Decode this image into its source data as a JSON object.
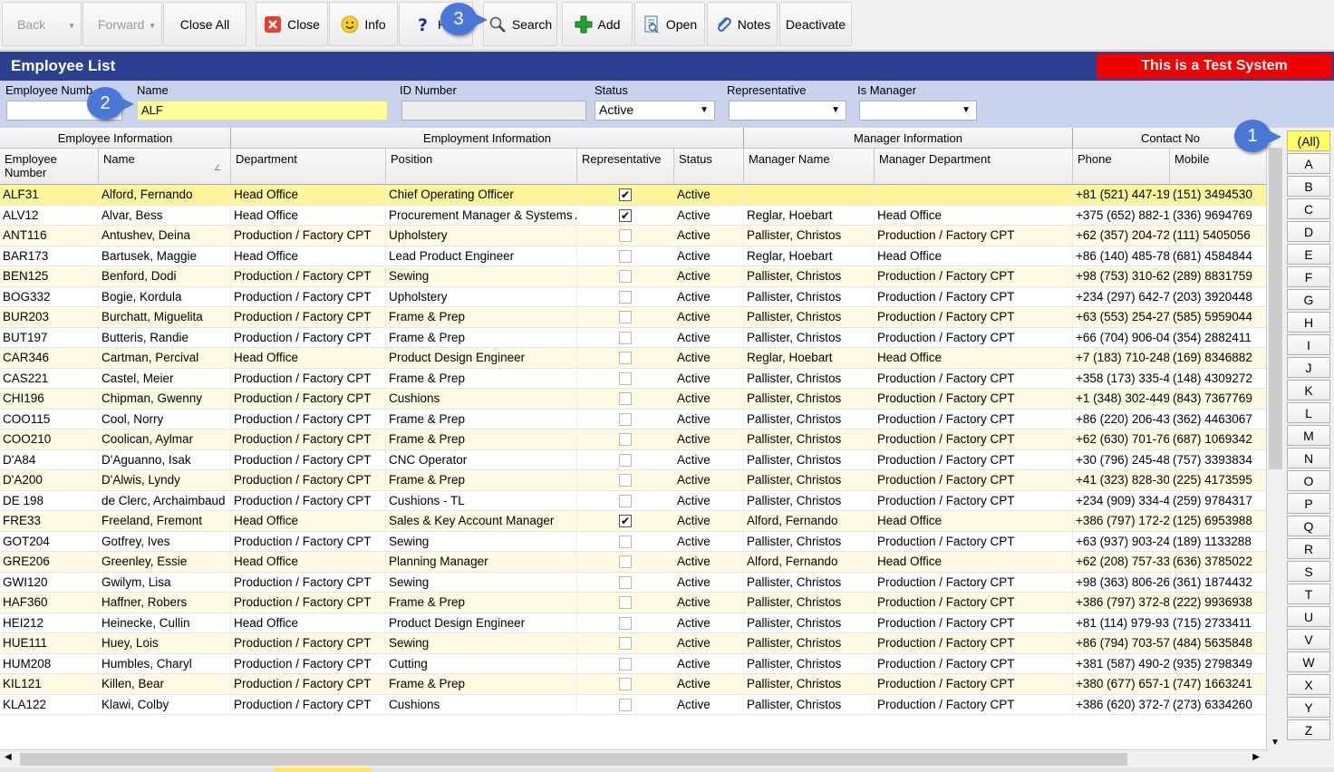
{
  "toolbar": {
    "back": "Back",
    "forward": "Forward",
    "close_all": "Close All",
    "close": "Close",
    "info": "Info",
    "help": "H",
    "search": "Search",
    "add": "Add",
    "open": "Open",
    "notes": "Notes",
    "deactivate": "Deactivate"
  },
  "title": "Employee List",
  "test_banner": "This is a Test System",
  "filters": {
    "employee_number_label": "Employee Numb",
    "employee_number_value": "",
    "name_label": "Name",
    "name_value": "ALF",
    "id_number_label": "ID Number",
    "id_number_value": "",
    "status_label": "Status",
    "status_value": "Active",
    "representative_label": "Representative",
    "representative_value": "",
    "is_manager_label": "Is Manager",
    "is_manager_value": ""
  },
  "groups": {
    "employee_info": "Employee Information",
    "employment_info": "Employment Information",
    "manager_info": "Manager Information",
    "contact": "Contact No"
  },
  "columns": {
    "emp_no": "Employee Number",
    "name": "Name",
    "department": "Department",
    "position": "Position",
    "representative": "Representative",
    "status": "Status",
    "manager_name": "Manager Name",
    "manager_dept": "Manager Department",
    "phone": "Phone",
    "mobile": "Mobile"
  },
  "rows": [
    {
      "emp": "ALF31",
      "name": "Alford, Fernando",
      "dept": "Head Office",
      "pos": "Chief Operating Officer",
      "rep": true,
      "status": "Active",
      "mgr": "",
      "mgrdept": "",
      "phone": "+81 (521) 447-19",
      "mobile": "(151) 3494530"
    },
    {
      "emp": "ALV12",
      "name": "Alvar, Bess",
      "dept": "Head Office",
      "pos": "Procurement Manager & Systems A",
      "rep": true,
      "status": "Active",
      "mgr": "Reglar, Hoebart",
      "mgrdept": "Head Office",
      "phone": "+375 (652) 882-1",
      "mobile": "(336) 9694769"
    },
    {
      "emp": "ANT116",
      "name": "Antushev, Deina",
      "dept": "Production / Factory CPT",
      "pos": "Upholstery",
      "rep": false,
      "status": "Active",
      "mgr": "Pallister, Christos",
      "mgrdept": "Production / Factory CPT",
      "phone": "+62 (357) 204-72",
      "mobile": "(111) 5405056"
    },
    {
      "emp": "BAR173",
      "name": "Bartusek, Maggie",
      "dept": "Head Office",
      "pos": "Lead Product Engineer",
      "rep": false,
      "status": "Active",
      "mgr": "Reglar, Hoebart",
      "mgrdept": "Head Office",
      "phone": "+86 (140) 485-78",
      "mobile": "(681) 4584844"
    },
    {
      "emp": "BEN125",
      "name": "Benford, Dodi",
      "dept": "Production / Factory CPT",
      "pos": "Sewing",
      "rep": false,
      "status": "Active",
      "mgr": "Pallister, Christos",
      "mgrdept": "Production / Factory CPT",
      "phone": "+98 (753) 310-62",
      "mobile": "(289) 8831759"
    },
    {
      "emp": "BOG332",
      "name": "Bogie, Kordula",
      "dept": "Production / Factory CPT",
      "pos": "Upholstery",
      "rep": false,
      "status": "Active",
      "mgr": "Pallister, Christos",
      "mgrdept": "Production / Factory CPT",
      "phone": "+234 (297) 642-7",
      "mobile": "(203) 3920448"
    },
    {
      "emp": "BUR203",
      "name": "Burchatt, Miguelita",
      "dept": "Production / Factory CPT",
      "pos": "Frame & Prep",
      "rep": false,
      "status": "Active",
      "mgr": "Pallister, Christos",
      "mgrdept": "Production / Factory CPT",
      "phone": "+63 (553) 254-27",
      "mobile": "(585) 5959044"
    },
    {
      "emp": "BUT197",
      "name": "Butteris, Randie",
      "dept": "Production / Factory CPT",
      "pos": "Frame & Prep",
      "rep": false,
      "status": "Active",
      "mgr": "Pallister, Christos",
      "mgrdept": "Production / Factory CPT",
      "phone": "+66 (704) 906-04",
      "mobile": "(354) 2882411"
    },
    {
      "emp": "CAR346",
      "name": "Cartman, Percival",
      "dept": "Head Office",
      "pos": "Product Design Engineer",
      "rep": false,
      "status": "Active",
      "mgr": "Reglar, Hoebart",
      "mgrdept": "Head Office",
      "phone": "+7 (183) 710-248",
      "mobile": "(169) 8346882"
    },
    {
      "emp": "CAS221",
      "name": "Castel, Meier",
      "dept": "Production / Factory CPT",
      "pos": "Frame & Prep",
      "rep": false,
      "status": "Active",
      "mgr": "Pallister, Christos",
      "mgrdept": "Production / Factory CPT",
      "phone": "+358 (173) 335-4",
      "mobile": "(148) 4309272"
    },
    {
      "emp": "CHI196",
      "name": "Chipman, Gwenny",
      "dept": "Production / Factory CPT",
      "pos": "Cushions",
      "rep": false,
      "status": "Active",
      "mgr": "Pallister, Christos",
      "mgrdept": "Production / Factory CPT",
      "phone": "+1 (348) 302-449",
      "mobile": "(843) 7367769"
    },
    {
      "emp": "COO115",
      "name": "Cool, Norry",
      "dept": "Production / Factory CPT",
      "pos": "Frame & Prep",
      "rep": false,
      "status": "Active",
      "mgr": "Pallister, Christos",
      "mgrdept": "Production / Factory CPT",
      "phone": "+86 (220) 206-43",
      "mobile": "(362) 4463067"
    },
    {
      "emp": "COO210",
      "name": "Coolican, Aylmar",
      "dept": "Production / Factory CPT",
      "pos": "Frame & Prep",
      "rep": false,
      "status": "Active",
      "mgr": "Pallister, Christos",
      "mgrdept": "Production / Factory CPT",
      "phone": "+62 (630) 701-76",
      "mobile": "(687) 1069342"
    },
    {
      "emp": "D'A84",
      "name": "D'Aguanno, Isak",
      "dept": "Production / Factory CPT",
      "pos": "CNC Operator",
      "rep": false,
      "status": "Active",
      "mgr": "Pallister, Christos",
      "mgrdept": "Production / Factory CPT",
      "phone": "+30 (796) 245-48",
      "mobile": "(757) 3393834"
    },
    {
      "emp": "D'A200",
      "name": "D'Alwis, Lyndy",
      "dept": "Production / Factory CPT",
      "pos": "Frame & Prep",
      "rep": false,
      "status": "Active",
      "mgr": "Pallister, Christos",
      "mgrdept": "Production / Factory CPT",
      "phone": "+41 (323) 828-30",
      "mobile": "(225) 4173595"
    },
    {
      "emp": "DE 198",
      "name": "de Clerc, Archaimbaud",
      "dept": "Production / Factory CPT",
      "pos": "Cushions - TL",
      "rep": false,
      "status": "Active",
      "mgr": "Pallister, Christos",
      "mgrdept": "Production / Factory CPT",
      "phone": "+234 (909) 334-4",
      "mobile": "(259) 9784317"
    },
    {
      "emp": "FRE33",
      "name": "Freeland, Fremont",
      "dept": "Head Office",
      "pos": "Sales & Key Account Manager",
      "rep": true,
      "status": "Active",
      "mgr": "Alford, Fernando",
      "mgrdept": "Head Office",
      "phone": "+386 (797) 172-2",
      "mobile": "(125) 6953988"
    },
    {
      "emp": "GOT204",
      "name": "Gotfrey, Ives",
      "dept": "Production / Factory CPT",
      "pos": "Sewing",
      "rep": false,
      "status": "Active",
      "mgr": "Pallister, Christos",
      "mgrdept": "Production / Factory CPT",
      "phone": "+63 (937) 903-24",
      "mobile": "(189) 1133288"
    },
    {
      "emp": "GRE206",
      "name": "Greenley, Essie",
      "dept": "Head Office",
      "pos": "Planning Manager",
      "rep": false,
      "status": "Active",
      "mgr": "Alford, Fernando",
      "mgrdept": "Head Office",
      "phone": "+62 (208) 757-33",
      "mobile": "(636) 3785022"
    },
    {
      "emp": "GWI120",
      "name": "Gwilym, Lisa",
      "dept": "Production / Factory CPT",
      "pos": "Sewing",
      "rep": false,
      "status": "Active",
      "mgr": "Pallister, Christos",
      "mgrdept": "Production / Factory CPT",
      "phone": "+98 (363) 806-26",
      "mobile": "(361) 1874432"
    },
    {
      "emp": "HAF360",
      "name": "Haffner, Robers",
      "dept": "Production / Factory CPT",
      "pos": "Frame & Prep",
      "rep": false,
      "status": "Active",
      "mgr": "Pallister, Christos",
      "mgrdept": "Production / Factory CPT",
      "phone": "+386 (797) 372-8",
      "mobile": "(222) 9936938"
    },
    {
      "emp": "HEI212",
      "name": "Heinecke, Cullin",
      "dept": "Head Office",
      "pos": "Product Design Engineer",
      "rep": false,
      "status": "Active",
      "mgr": "Pallister, Christos",
      "mgrdept": "Production / Factory CPT",
      "phone": "+81 (114) 979-93",
      "mobile": "(715) 2733411"
    },
    {
      "emp": "HUE111",
      "name": "Huey, Lois",
      "dept": "Production / Factory CPT",
      "pos": "Sewing",
      "rep": false,
      "status": "Active",
      "mgr": "Pallister, Christos",
      "mgrdept": "Production / Factory CPT",
      "phone": "+86 (794) 703-57",
      "mobile": "(484) 5635848"
    },
    {
      "emp": "HUM208",
      "name": "Humbles, Charyl",
      "dept": "Production / Factory CPT",
      "pos": "Cutting",
      "rep": false,
      "status": "Active",
      "mgr": "Pallister, Christos",
      "mgrdept": "Production / Factory CPT",
      "phone": "+381 (587) 490-2",
      "mobile": "(935) 2798349"
    },
    {
      "emp": "KIL121",
      "name": "Killen, Bear",
      "dept": "Production / Factory CPT",
      "pos": "Frame & Prep",
      "rep": false,
      "status": "Active",
      "mgr": "Pallister, Christos",
      "mgrdept": "Production / Factory CPT",
      "phone": "+380 (677) 657-1",
      "mobile": "(747) 1663241"
    },
    {
      "emp": "KLA122",
      "name": "Klawi, Colby",
      "dept": "Production / Factory CPT",
      "pos": "Cushions",
      "rep": false,
      "status": "Active",
      "mgr": "Pallister, Christos",
      "mgrdept": "Production / Factory CPT",
      "phone": "+386 (620) 372-7",
      "mobile": "(273) 6334260"
    }
  ],
  "letters": [
    "(All)",
    "A",
    "B",
    "C",
    "D",
    "E",
    "F",
    "G",
    "H",
    "I",
    "J",
    "K",
    "L",
    "M",
    "N",
    "O",
    "P",
    "Q",
    "R",
    "S",
    "T",
    "U",
    "V",
    "W",
    "X",
    "Y",
    "Z"
  ],
  "callouts": [
    "1",
    "2",
    "3"
  ],
  "check_glyph": "✔",
  "sort_glyph": "∠"
}
